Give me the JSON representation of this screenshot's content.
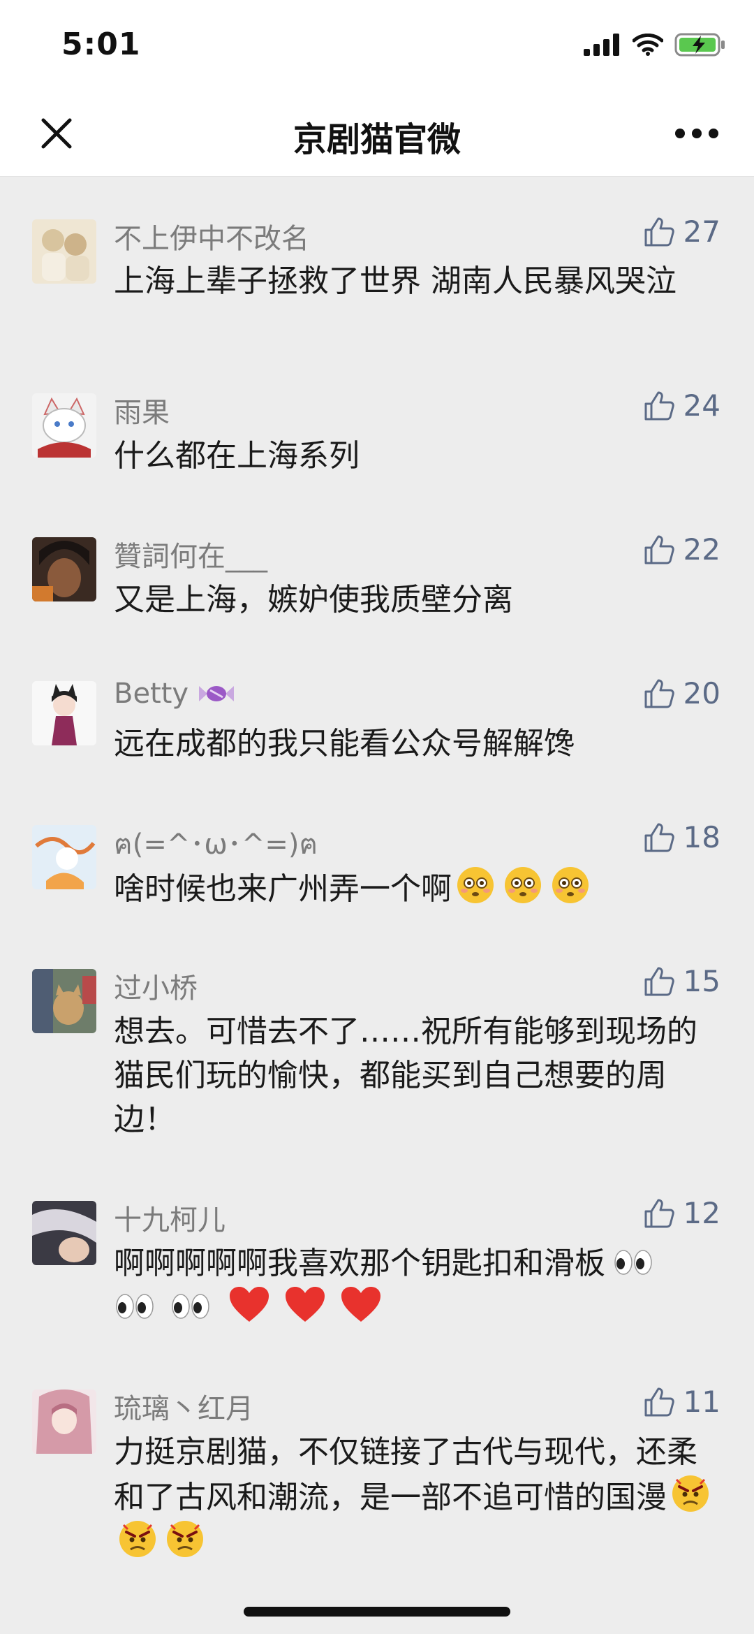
{
  "status_bar": {
    "time": "5:01"
  },
  "nav": {
    "title": "京剧猫官微"
  },
  "colors": {
    "accent_like": "#5b6a86",
    "heart": "#e8322d",
    "emoji_yellow": "#f7c433"
  },
  "comments": [
    {
      "name": "不上伊中不改名",
      "likes": "27",
      "text": "上海上辈子拯救了世界 湖南人民暴风哭泣",
      "avatar_icon": "anime-girls-avatar"
    },
    {
      "name": "雨果",
      "likes": "24",
      "text": "什么都在上海系列",
      "avatar_icon": "white-cat-avatar"
    },
    {
      "name": "贊詞何在___",
      "likes": "22",
      "text": "又是上海，嫉妒使我质壁分离",
      "avatar_icon": "dark-hair-boy-avatar"
    },
    {
      "name": "Betty",
      "name_emoji": "candy-icon",
      "likes": "20",
      "text": "远在成都的我只能看公众号解解馋",
      "avatar_icon": "cat-girl-avatar"
    },
    {
      "name": "ฅ(=^･ω･^=)ฅ",
      "likes": "18",
      "text": "啥时候也来广州弄一个啊",
      "emoji_suffix": [
        "flushed-emoji",
        "flushed-emoji",
        "flushed-emoji"
      ],
      "avatar_icon": "fox-spirit-avatar"
    },
    {
      "name": "过小桥",
      "likes": "15",
      "text": "想去。可惜去不了……祝所有能够到现场的猫民们玩的愉快，都能买到自己想要的周边！",
      "avatar_icon": "cat-figurine-avatar"
    },
    {
      "name": "十九柯儿",
      "likes": "12",
      "text": "啊啊啊啊啊我喜欢那个钥匙扣和滑板",
      "emoji_suffix": [
        "eyes-emoji",
        "eyes-emoji",
        "eyes-emoji",
        "heart-emoji",
        "heart-emoji",
        "heart-emoji"
      ],
      "avatar_icon": "silver-hair-avatar"
    },
    {
      "name": "琉璃丶红月",
      "likes": "11",
      "text": "力挺京剧猫，不仅链接了古代与现代，还柔和了古风和潮流，是一部不追可惜的国漫",
      "emoji_suffix": [
        "angry-face-emoji",
        "angry-face-emoji",
        "angry-face-emoji"
      ],
      "avatar_icon": "pink-hair-girl-avatar"
    }
  ]
}
